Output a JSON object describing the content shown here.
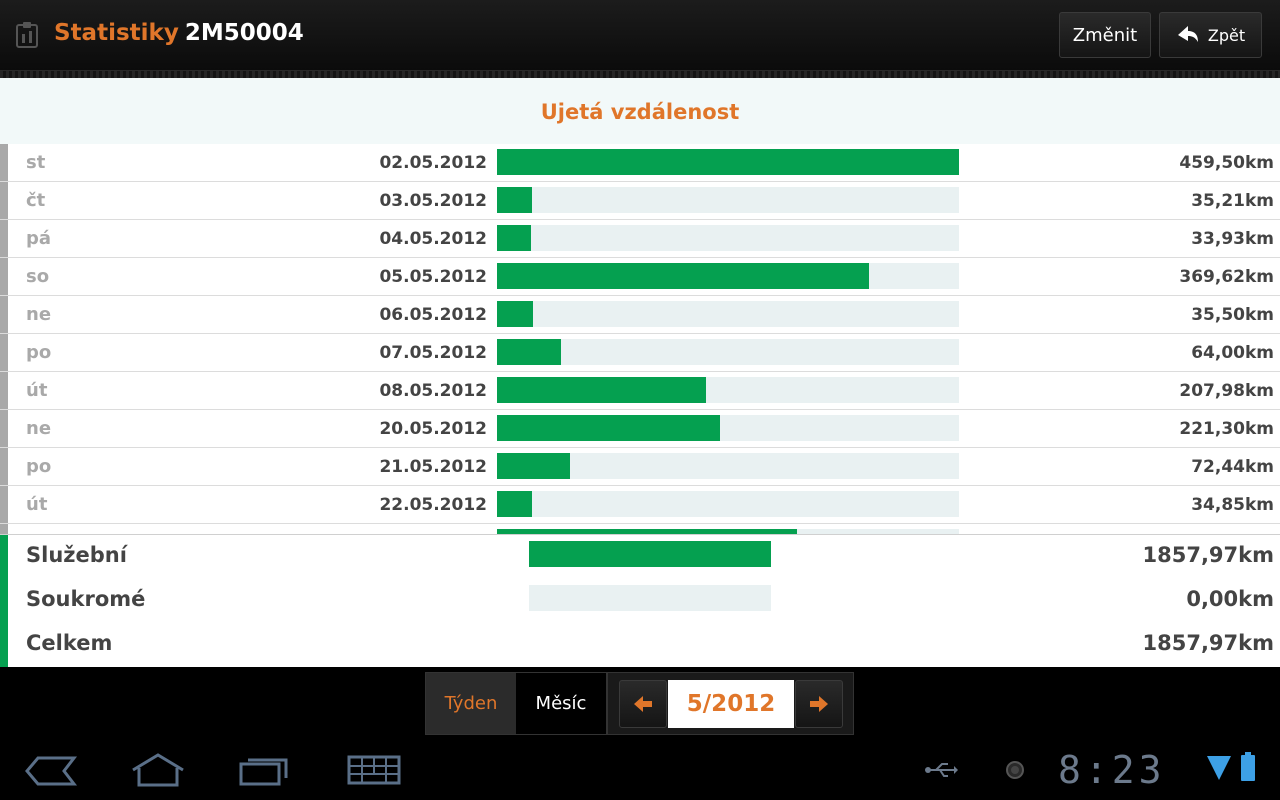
{
  "header": {
    "title_prefix": "Statistiky",
    "title_vehicle": "2M50004",
    "change_label": "Změnit",
    "back_label": "Zpět",
    "app_icon": "clipboard-icon",
    "back_icon": "back-arrow-icon"
  },
  "panel": {
    "title": "Ujetá vzdálenost",
    "max_value": 459.5,
    "rows": [
      {
        "day": "st",
        "date": "02.05.2012",
        "value": 459.5,
        "label": "459,50km"
      },
      {
        "day": "čt",
        "date": "03.05.2012",
        "value": 35.21,
        "label": "35,21km"
      },
      {
        "day": "pá",
        "date": "04.05.2012",
        "value": 33.93,
        "label": "33,93km"
      },
      {
        "day": "so",
        "date": "05.05.2012",
        "value": 369.62,
        "label": "369,62km"
      },
      {
        "day": "ne",
        "date": "06.05.2012",
        "value": 35.5,
        "label": "35,50km"
      },
      {
        "day": "po",
        "date": "07.05.2012",
        "value": 64.0,
        "label": "64,00km"
      },
      {
        "day": "út",
        "date": "08.05.2012",
        "value": 207.98,
        "label": "207,98km"
      },
      {
        "day": "ne",
        "date": "20.05.2012",
        "value": 221.3,
        "label": "221,30km"
      },
      {
        "day": "po",
        "date": "21.05.2012",
        "value": 72.44,
        "label": "72,44km"
      },
      {
        "day": "út",
        "date": "22.05.2012",
        "value": 34.85,
        "label": "34,85km"
      },
      {
        "day": "",
        "date": "",
        "value": 298.0,
        "label": ""
      }
    ]
  },
  "summary": {
    "business": {
      "label": "Služební",
      "value": "1857,97km",
      "fraction": 1.0
    },
    "private": {
      "label": "Soukromé",
      "value": "0,00km",
      "fraction": 0.0
    },
    "total": {
      "label": "Celkem",
      "value": "1857,97km"
    }
  },
  "period": {
    "week_label": "Týden",
    "month_label": "Měsíc",
    "current": "5/2012",
    "selected_tab": "week"
  },
  "system": {
    "clock": "8:23",
    "icons": [
      "back-nav-icon",
      "home-icon",
      "recent-apps-icon",
      "keyboard-icon",
      "usb-icon",
      "notification-dot-icon",
      "wifi-icon",
      "battery-icon"
    ]
  },
  "colors": {
    "accent": "#e0762a",
    "bar": "#05a050",
    "track": "#e9f1f2"
  }
}
